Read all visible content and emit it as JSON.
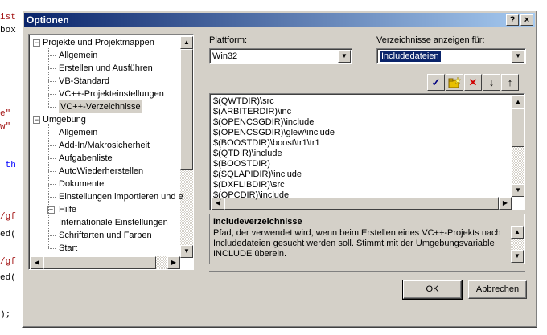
{
  "background_code": {
    "lines": [
      {
        "text": "ist",
        "color": "red"
      },
      {
        "text": "box",
        "color": "black"
      },
      {
        "text": "e\"",
        "color": "red"
      },
      {
        "text": "w\"",
        "color": "red"
      },
      {
        "text": " th",
        "color": "blue"
      },
      {
        "text": "/gf",
        "color": "red"
      },
      {
        "text": "ed(",
        "color": "black"
      },
      {
        "text": "/gf",
        "color": "red"
      },
      {
        "text": "ed(",
        "color": "black"
      },
      {
        "text": ");",
        "color": "black"
      }
    ]
  },
  "dialog": {
    "title": "Optionen",
    "help_button": "?",
    "close_button": "×"
  },
  "tree": {
    "groups": [
      {
        "label": "Projekte und Projektmappen",
        "expanded": true,
        "items": [
          "Allgemein",
          "Erstellen und Ausführen",
          "VB-Standard",
          "VC++-Projekteinstellungen",
          "VC++-Verzeichnisse"
        ]
      },
      {
        "label": "Umgebung",
        "expanded": true,
        "items": [
          "Allgemein",
          "Add-In/Makrosicherheit",
          "Aufgabenliste",
          "AutoWiederherstellen",
          "Dokumente",
          "Einstellungen importieren und e",
          "Hilfe",
          "Internationale Einstellungen",
          "Schriftarten und Farben",
          "Start"
        ]
      }
    ],
    "selected": "VC++-Verzeichnisse"
  },
  "platform": {
    "label": "Plattform:",
    "value": "Win32"
  },
  "directories_for": {
    "label": "Verzeichnisse anzeigen für:",
    "value": "Includedateien"
  },
  "toolbar": {
    "buttons": [
      {
        "name": "check-icon",
        "glyph": "✓",
        "color": "#000080"
      },
      {
        "name": "new-folder-icon",
        "glyph": "",
        "color": "#c0a000"
      },
      {
        "name": "delete-icon",
        "glyph": "✕",
        "color": "#d00000"
      },
      {
        "name": "move-down-icon",
        "glyph": "↓",
        "color": "#000000"
      },
      {
        "name": "move-up-icon",
        "glyph": "↑",
        "color": "#000000"
      }
    ]
  },
  "directory_list": [
    "$(QWTDIR)\\src",
    "$(ARBITERDIR)\\inc",
    "$(OPENCSGDIR)\\include",
    "$(OPENCSGDIR)\\glew\\include",
    "$(BOOSTDIR)\\boost\\tr1\\tr1",
    "$(QTDIR)\\include",
    "$(BOOSTDIR)",
    "$(SQLAPIDIR)\\include",
    "$(DXFLIBDIR)\\src",
    "$(OPCDIR)\\include"
  ],
  "description": {
    "title": "Includeverzeichnisse",
    "text": "Pfad, der verwendet wird, wenn beim Erstellen eines VC++-Projekts nach Includedateien gesucht werden soll. Stimmt mit der Umgebungsvariable INCLUDE überein."
  },
  "buttons": {
    "ok": "OK",
    "cancel": "Abbrechen"
  },
  "colors": {
    "titlebar_start": "#0a246a",
    "titlebar_end": "#a6caf0",
    "dialog_face": "#d4d0c8",
    "selection": "#0a246a"
  }
}
